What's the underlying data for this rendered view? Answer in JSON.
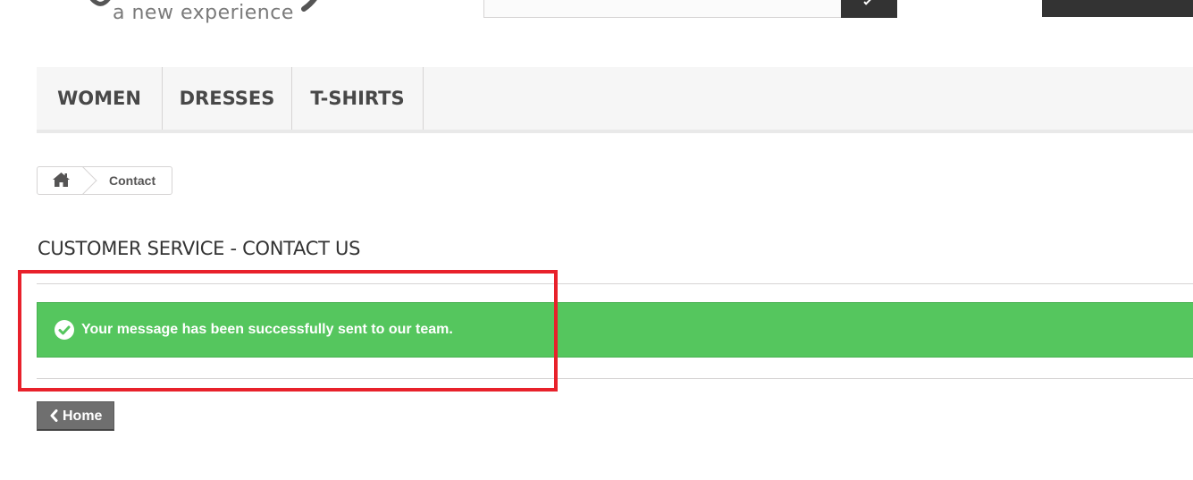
{
  "header": {
    "logo_tagline": "a new experience",
    "search": {
      "value": "",
      "button_icon": "search-icon"
    }
  },
  "menu": {
    "items": [
      {
        "label": "WOMEN"
      },
      {
        "label": "DRESSES"
      },
      {
        "label": "T-SHIRTS"
      }
    ]
  },
  "breadcrumb": {
    "home_icon": "home-icon",
    "current": "Contact"
  },
  "page": {
    "title": "CUSTOMER SERVICE - CONTACT US"
  },
  "alert": {
    "type": "success",
    "icon": "check-circle-icon",
    "message": "Your message has been successfully sent to our team."
  },
  "actions": {
    "home_icon": "chevron-left-icon",
    "home_label": "Home"
  },
  "colors": {
    "success_green": "#55c65e",
    "highlight_red": "#e8212b",
    "menu_background": "#f6f6f6",
    "dark_button": "#333333"
  }
}
